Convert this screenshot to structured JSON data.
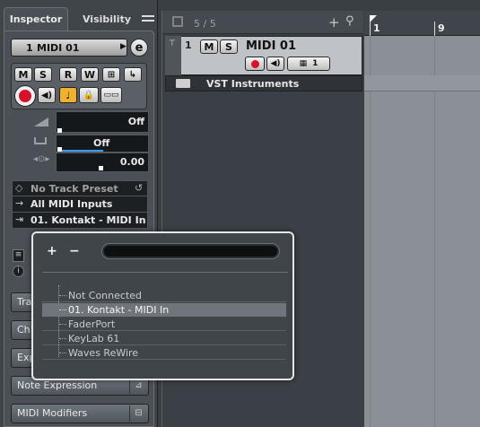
{
  "inspector": {
    "tab_inspector": "Inspector",
    "tab_visibility": "Visibility",
    "track_number": "1",
    "track_name": "MIDI 01",
    "edit_label": "e",
    "btn_m": "M",
    "btn_s": "S",
    "btn_r": "R",
    "btn_w": "W",
    "volume_value": "Off",
    "pan_value": "Off",
    "delay_value": "0.00",
    "preset": "No Track Preset",
    "midi_input": "All MIDI Inputs",
    "midi_output": "01. Kontakt - MIDI In",
    "sections": [
      "Tra",
      "Ch",
      "Exp",
      "Note Expression",
      "MIDI Modifiers"
    ]
  },
  "project": {
    "track_count": "5 / 5",
    "track_number": "1",
    "track_name": "MIDI 01",
    "btn_m": "M",
    "btn_s": "S",
    "channel": "1",
    "folder_name": "VST Instruments",
    "ruler_marks": [
      "1",
      "9"
    ]
  },
  "popup": {
    "plus": "+",
    "minus": "−",
    "search_value": "",
    "items": [
      "Not Connected",
      "01. Kontakt - MIDI In",
      "FaderPort",
      "KeyLab 61",
      "Waves ReWire"
    ],
    "selected_index": 1
  }
}
